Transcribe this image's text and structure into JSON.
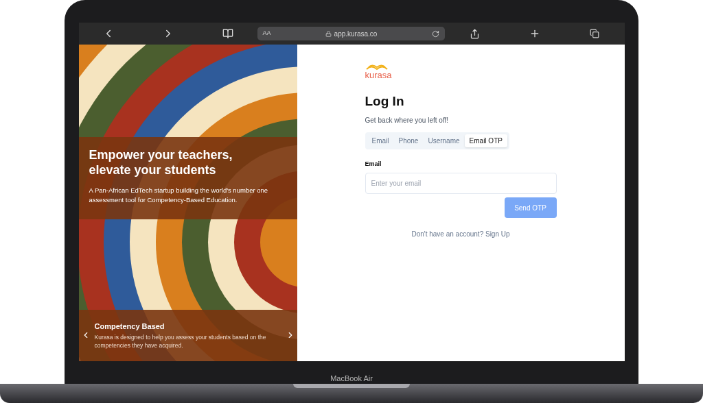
{
  "device": {
    "label": "MacBook Air"
  },
  "browser": {
    "text_size_button": "AA",
    "url": "app.kurasa.co"
  },
  "hero": {
    "title": "Empower your teachers, elevate your students",
    "description": "A Pan-African EdTech startup building the world's number one assessment tool for Competency-Based Education."
  },
  "carousel": {
    "title": "Competency Based",
    "description": "Kurasa is designed to help you assess your students based on the competencies they have acquired."
  },
  "logo": {
    "text": "kurasa"
  },
  "login": {
    "title": "Log In",
    "subtitle": "Get back where you left off!",
    "tabs": [
      {
        "label": "Email",
        "selected": false
      },
      {
        "label": "Phone",
        "selected": false
      },
      {
        "label": "Username",
        "selected": false
      },
      {
        "label": "Email OTP",
        "selected": true
      }
    ],
    "field_label": "Email",
    "placeholder": "Enter your email",
    "submit": {
      "label": "Send OTP",
      "disabled": true
    },
    "signup_text": "Don't have an account? Sign Up"
  }
}
